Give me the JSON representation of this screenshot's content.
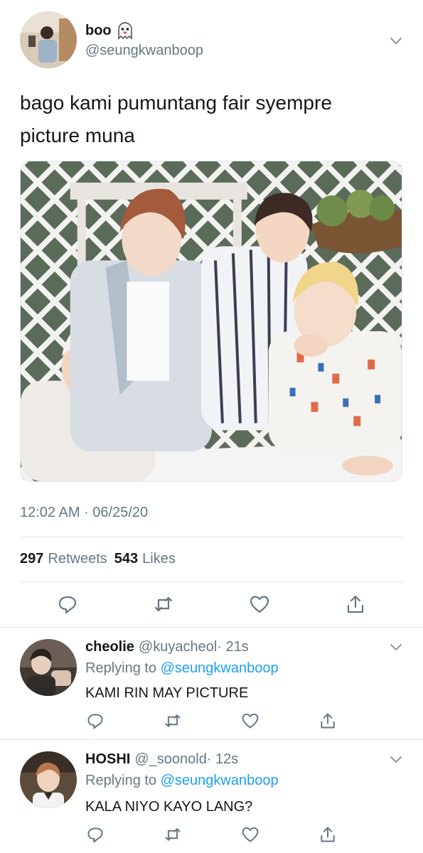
{
  "main_tweet": {
    "display_name": "boo",
    "name_emoji_icon": "ghost-emoji-icon",
    "handle": "@seungkwanboop",
    "text_line1": "bago kami pumuntang fair syempre",
    "text_line2": "picture muna",
    "timestamp": "12:02 AM · 06/25/20",
    "retweets_count": "297",
    "retweets_label": "Retweets",
    "likes_count": "543",
    "likes_label": "Likes",
    "photo_icon": "group-photo-image"
  },
  "replies": [
    {
      "display_name": "cheolie",
      "handle": "@kuyacheol",
      "time": "· 21s",
      "replying_prefix": "Replying to",
      "replying_to": "@seungkwanboop",
      "text": "KAMI RIN MAY PICTURE"
    },
    {
      "display_name": "HOSHI",
      "handle": "@_soonold",
      "time": "· 12s",
      "replying_prefix": "Replying to",
      "replying_to": "@seungkwanboop",
      "text": "KALA NIYO KAYO LANG?"
    }
  ],
  "icons": {
    "reply": "reply-icon",
    "retweet": "retweet-icon",
    "like": "heart-icon",
    "share": "share-icon",
    "more": "chevron-down-icon"
  },
  "colors": {
    "text_primary": "#14171a",
    "text_secondary": "#657786",
    "link": "#1da1f2",
    "divider": "#e1e8ed"
  }
}
